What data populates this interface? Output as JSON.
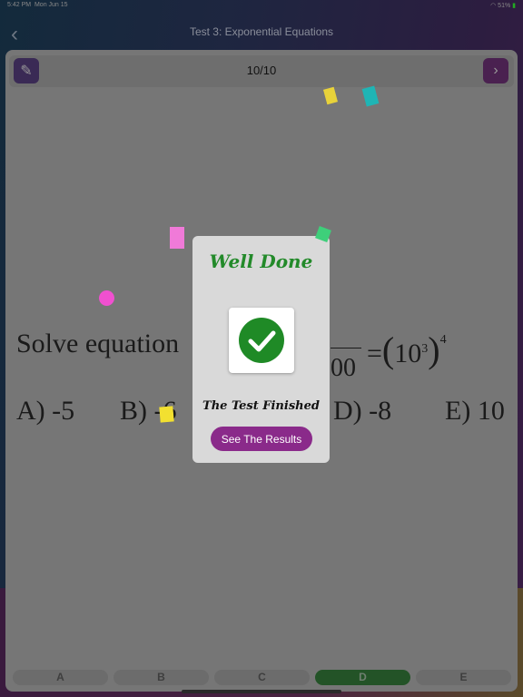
{
  "status": {
    "time": "5:42 PM",
    "date": "Mon Jun 15",
    "battery": "51%"
  },
  "nav": {
    "title": "Test 3: Exponential Equations"
  },
  "toolbar": {
    "counter": "10/10"
  },
  "question": {
    "prefix": "Solve equation",
    "denominator": "00",
    "rhs_base": "10",
    "rhs_inner_exp": "3",
    "rhs_outer_exp": "4",
    "options": [
      "A) -5",
      "B) -6",
      "D) -8",
      "E) 10"
    ]
  },
  "answers": [
    {
      "label": "A",
      "selected": false
    },
    {
      "label": "B",
      "selected": false
    },
    {
      "label": "C",
      "selected": false
    },
    {
      "label": "D",
      "selected": true
    },
    {
      "label": "E",
      "selected": false
    }
  ],
  "dialog": {
    "title": "Well Done",
    "icon": "check-circle-icon",
    "subtitle": "The Test Finished",
    "button": "See The Results"
  },
  "colors": {
    "accent": "#8a2a8a",
    "success": "#238a2a",
    "selected": "#235327"
  }
}
